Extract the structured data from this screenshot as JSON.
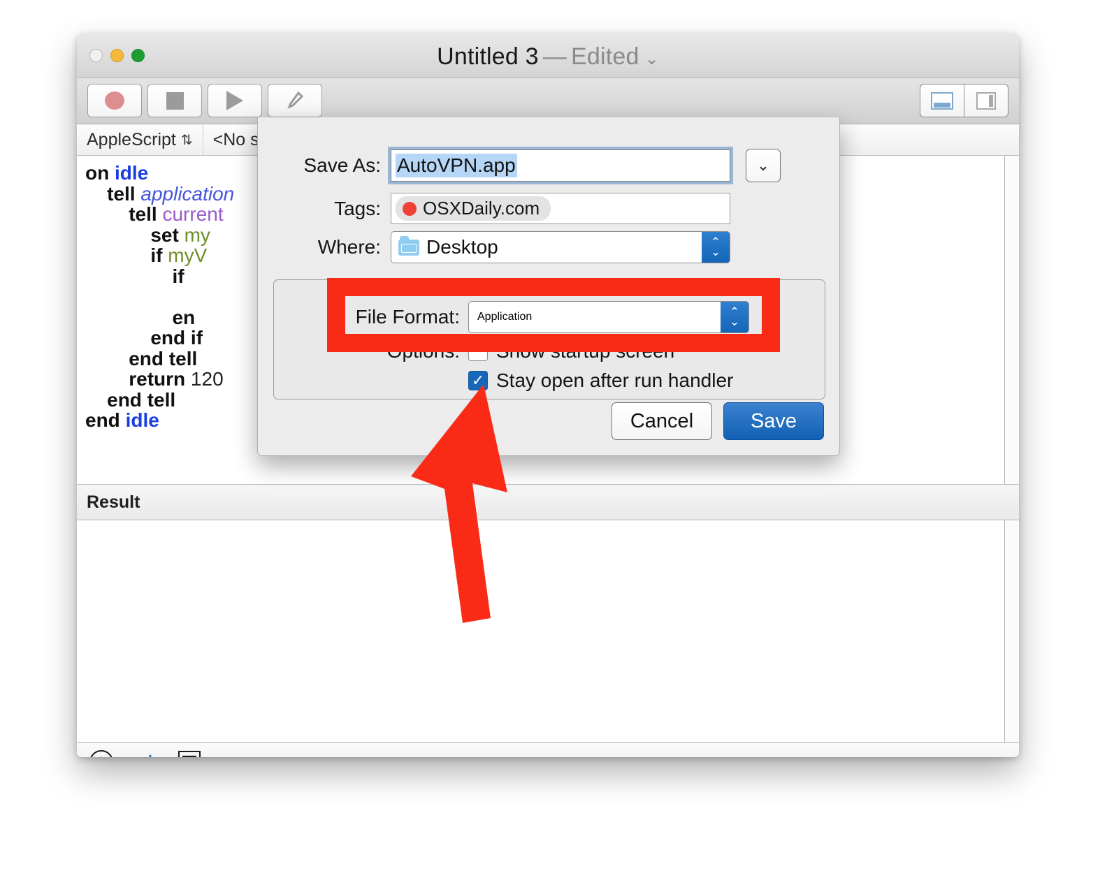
{
  "window": {
    "title_doc": "Untitled 3",
    "title_dash": "—",
    "title_edited": "Edited",
    "title_chevron": "⌄",
    "traffic": {
      "close": "close-button",
      "minimize": "minimize-button",
      "zoom": "zoom-button"
    }
  },
  "toolbar": {
    "record_label": "Record",
    "stop_label": "Stop",
    "run_label": "Run",
    "compile_label": "Compile",
    "hammer_glyph": "⟋",
    "view_bottom_label": "Show bottom pane",
    "view_side_label": "Show side pane"
  },
  "scriptbar": {
    "language": "AppleScript",
    "language_chevron": "⇅",
    "selection": "<No se"
  },
  "code": {
    "lines": [
      "on idle",
      "    tell application",
      "        tell current",
      "            set my",
      "            if myV",
      "                if",
      "",
      "                en",
      "            end if",
      "        end tell",
      "        return 120",
      "    end tell",
      "end idle"
    ],
    "tokens": {
      "on": "on",
      "idle": "idle",
      "tell": "tell",
      "application": "application",
      "current": "current",
      "set": "set",
      "my": "my",
      "if": "if",
      "end": "end",
      "endif": "end if",
      "endtell": "end tell",
      "return": "return",
      "number": "120",
      "endidle": "end idle",
      "en_partial": "en",
      "myv_partial": "myV"
    }
  },
  "result": {
    "header": "Result",
    "body": ""
  },
  "statusbar": {
    "info_glyph": "i",
    "info_label": "description-icon",
    "return_glyph": "↵",
    "return_label": "event-log-icon",
    "lines_label": "log-icon"
  },
  "sheet": {
    "save_as_label": "Save As:",
    "save_as_value": "AutoVPN.app",
    "expand_chevron": "⌄",
    "tags_label": "Tags:",
    "tag_value": "OSXDaily.com",
    "tag_color": "#ef4136",
    "where_label": "Where:",
    "where_value": "Desktop",
    "stepper_up": "⌃",
    "stepper_down": "⌄",
    "file_format_label": "File Format:",
    "file_format_value": "Application",
    "options_label": "Options:",
    "option_startup": "Show startup screen",
    "option_startup_checked": false,
    "option_stayopen": "Stay open after run handler",
    "option_stayopen_checked": true,
    "checkmark": "✓",
    "cancel_label": "Cancel",
    "save_label": "Save"
  },
  "annotations": {
    "highlight_color": "#f92b17",
    "highlight_target": "File Format: Application",
    "arrow_color": "#f92b17",
    "arrow_target": "Stay open after run handler"
  }
}
